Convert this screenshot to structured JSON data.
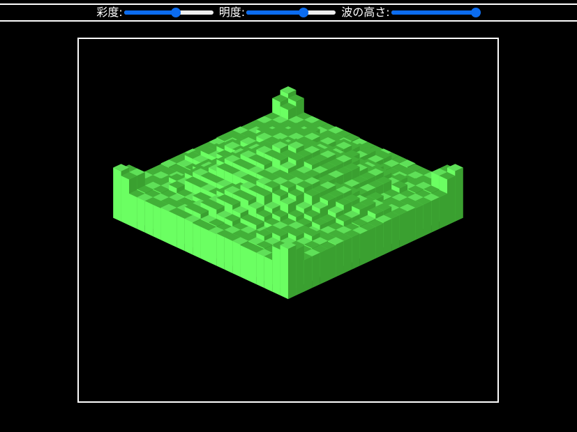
{
  "controls": [
    {
      "id": "saturation",
      "label": "彩度:",
      "value": 0.59
    },
    {
      "id": "brightness",
      "label": "明度:",
      "value": 0.66
    },
    {
      "id": "wave_height",
      "label": "波の高さ:",
      "value": 1.0
    }
  ],
  "scene": {
    "colors": {
      "top": "#42b038",
      "top_light": "#5fe058",
      "side_left": "#6bff62",
      "side_right": "#3aa030",
      "background": "#000000",
      "accent": "#0b6cf0"
    }
  }
}
